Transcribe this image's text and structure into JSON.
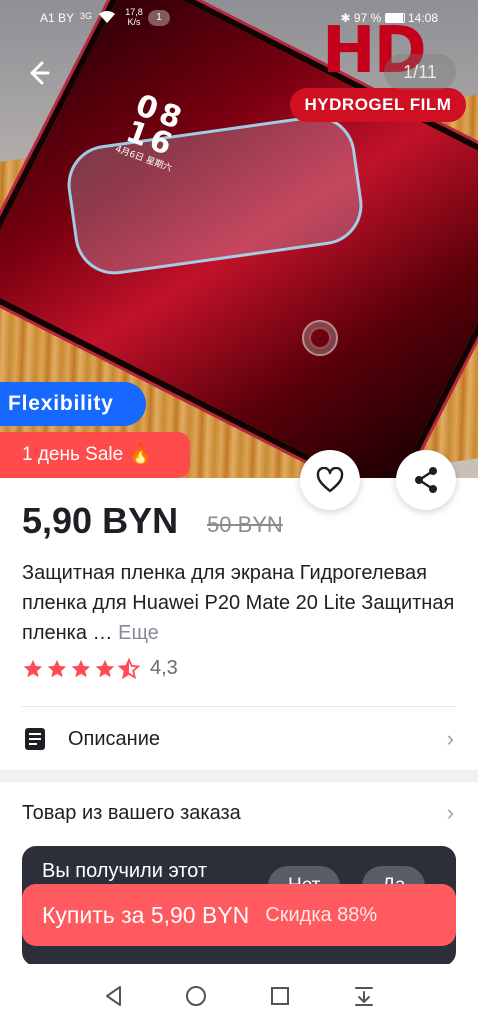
{
  "status_bar": {
    "carrier": "A1 BY",
    "network_type": "3G",
    "speed": "17,8 K/s",
    "notifications": "1",
    "battery": "97 %",
    "time": "14:08"
  },
  "gallery": {
    "counter": "1/11",
    "badge_hd": "HD",
    "badge_film": "HYDROGEL FILM",
    "flex_label": "Flexibility",
    "sale_label": "1 день Sale 🔥",
    "phone_clock": "08\n16",
    "phone_date": "4月6日 星期六"
  },
  "product": {
    "price": "5,90 BYN",
    "old_price": "50 BYN",
    "title": "Защитная пленка для экрана Гидрогелевая пленка для Huawei P20 Mate 20 Lite Защитная пленка …",
    "more": "Еще",
    "rating": "4,3",
    "rating_value": 4.3
  },
  "sections": {
    "description_label": "Описание",
    "order_label": "Товар из вашего заказа"
  },
  "review_prompt": {
    "text": "Вы получили этот",
    "no_label": "Нет",
    "yes_label": "Да"
  },
  "buy": {
    "label": "Купить за 5,90 BYN",
    "discount": "Скидка 88%"
  },
  "colors": {
    "accent": "#ff5a5f",
    "star": "#ff4b55",
    "sale": "#ff4b4b",
    "flex": "#1768ff"
  }
}
